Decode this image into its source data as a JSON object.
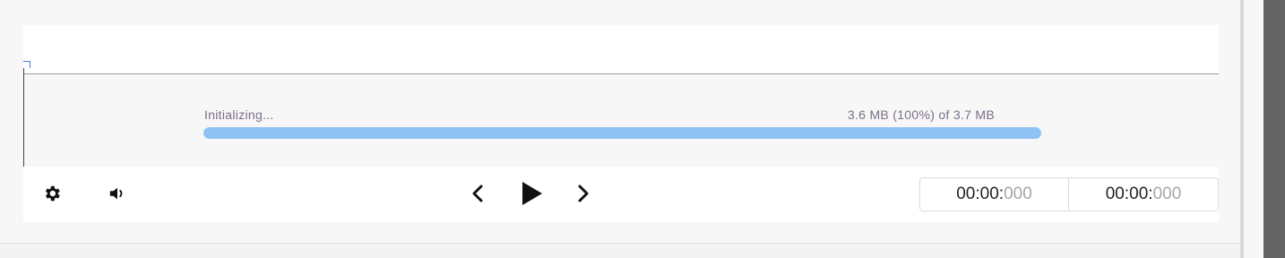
{
  "loader": {
    "status": "Initializing...",
    "size_text": "3.6 MB (100%) of 3.7 MB",
    "progress_fraction": 0.9999
  },
  "controls": {
    "settings_icon": "gear-icon",
    "volume_icon": "volume-icon",
    "prev_icon": "chevron-left-icon",
    "play_icon": "play-icon",
    "next_icon": "chevron-right-icon"
  },
  "time": {
    "start_main": "00:00:",
    "start_ms": "000",
    "end_main": "00:00:",
    "end_ms": "000"
  }
}
